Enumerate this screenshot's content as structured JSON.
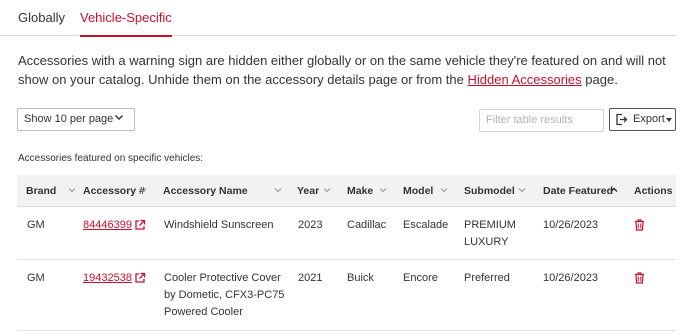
{
  "tabs": [
    {
      "label": "Globally"
    },
    {
      "label": "Vehicle-Specific"
    }
  ],
  "description": {
    "text_before": "Accessories with a warning sign are hidden either globally or on the same vehicle they're featured on and will not show on your catalog. Unhide them on the accessory details page or from the ",
    "link": "Hidden Accessories",
    "text_after": " page."
  },
  "controls": {
    "per_page": "Show 10 per page",
    "filter_placeholder": "Filter table results",
    "export_label": "Export"
  },
  "section_label": "Accessories featured on specific vehicles:",
  "table": {
    "columns": [
      "Brand",
      "Accessory #",
      "Accessory Name",
      "Year",
      "Make",
      "Model",
      "Submodel",
      "Date Featured",
      "Actions"
    ],
    "sorted_column": "Date Featured",
    "sort_direction": "ascending",
    "rows": [
      {
        "brand": "GM",
        "accessory_number": "84446399",
        "name_lines": [
          "Windshield Sunscreen"
        ],
        "year": "2023",
        "make": "Cadillac",
        "model": "Escalade",
        "submodel_lines": [
          "PREMIUM",
          "LUXURY"
        ],
        "date_featured": "10/26/2023"
      },
      {
        "brand": "GM",
        "accessory_number": "19432538",
        "name_lines": [
          "Cooler Protective Cover",
          "by Dometic, CFX3-PC75",
          "Powered Cooler"
        ],
        "year": "2021",
        "make": "Buick",
        "model": "Encore",
        "submodel_lines": [
          "Preferred"
        ],
        "date_featured": "10/26/2023"
      }
    ]
  },
  "icons": {
    "per_page_chevron": "chevron-down-icon",
    "export": "export-icon",
    "sort": "sort-chevron-icon",
    "external_link": "external-link-icon",
    "delete": "trash-icon"
  },
  "colors": {
    "accent": "#c8102e",
    "header_bg": "#f2f2f2",
    "text": "#333333"
  }
}
